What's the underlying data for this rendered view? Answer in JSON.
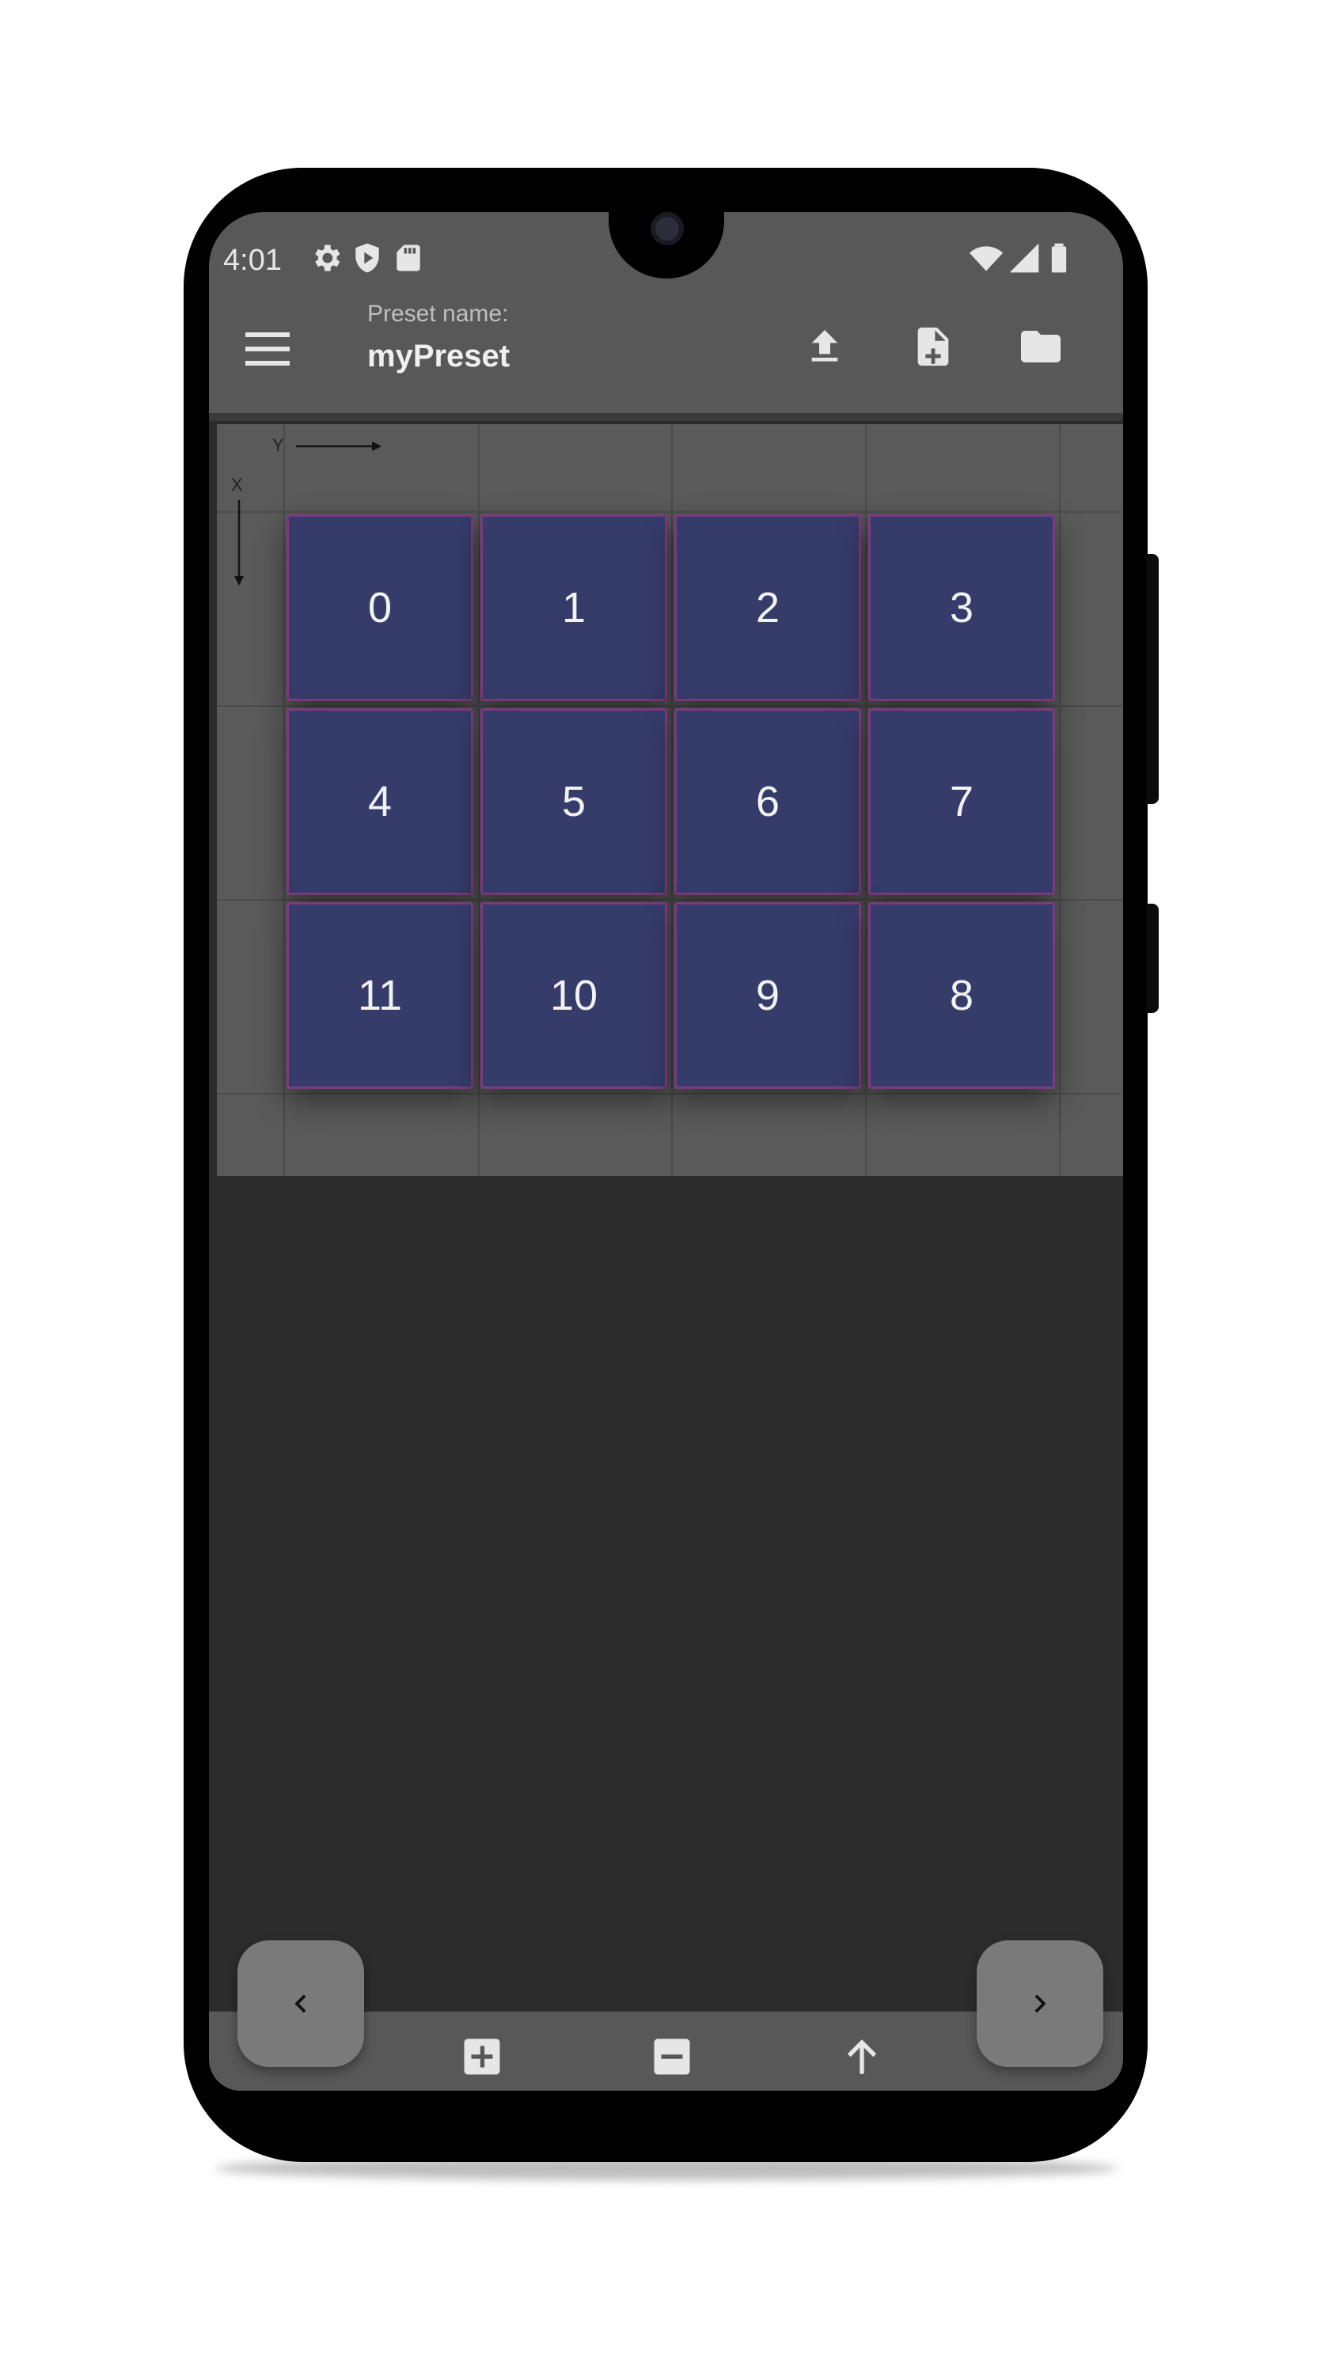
{
  "status_bar": {
    "time": "4:01",
    "left_icons": [
      "gear-icon",
      "shield-play-icon",
      "sd-card-icon"
    ],
    "right_icons": [
      "wifi-icon",
      "signal-icon",
      "battery-icon"
    ]
  },
  "app_bar": {
    "menu_icon": "hamburger-menu-icon",
    "preset_caption": "Preset name:",
    "preset_name": "myPreset",
    "actions": [
      "upload-icon",
      "new-file-icon",
      "folder-icon"
    ]
  },
  "grid": {
    "axis_y_label": "Y",
    "axis_x_label": "X",
    "rows": 3,
    "columns": 4,
    "tiles": [
      "0",
      "1",
      "2",
      "3",
      "4",
      "5",
      "6",
      "7",
      "11",
      "10",
      "9",
      "8"
    ]
  },
  "bottom_bar": {
    "actions": [
      "add-icon",
      "remove-icon",
      "arrow-up-icon"
    ]
  },
  "nav": {
    "prev_icon": "chevron-left-icon",
    "next_icon": "chevron-right-icon"
  },
  "colors": {
    "tile_fill": "#363c6a",
    "tile_border": "#7c3a82",
    "app_bar": "#585858",
    "background": "#2c2c2c"
  }
}
